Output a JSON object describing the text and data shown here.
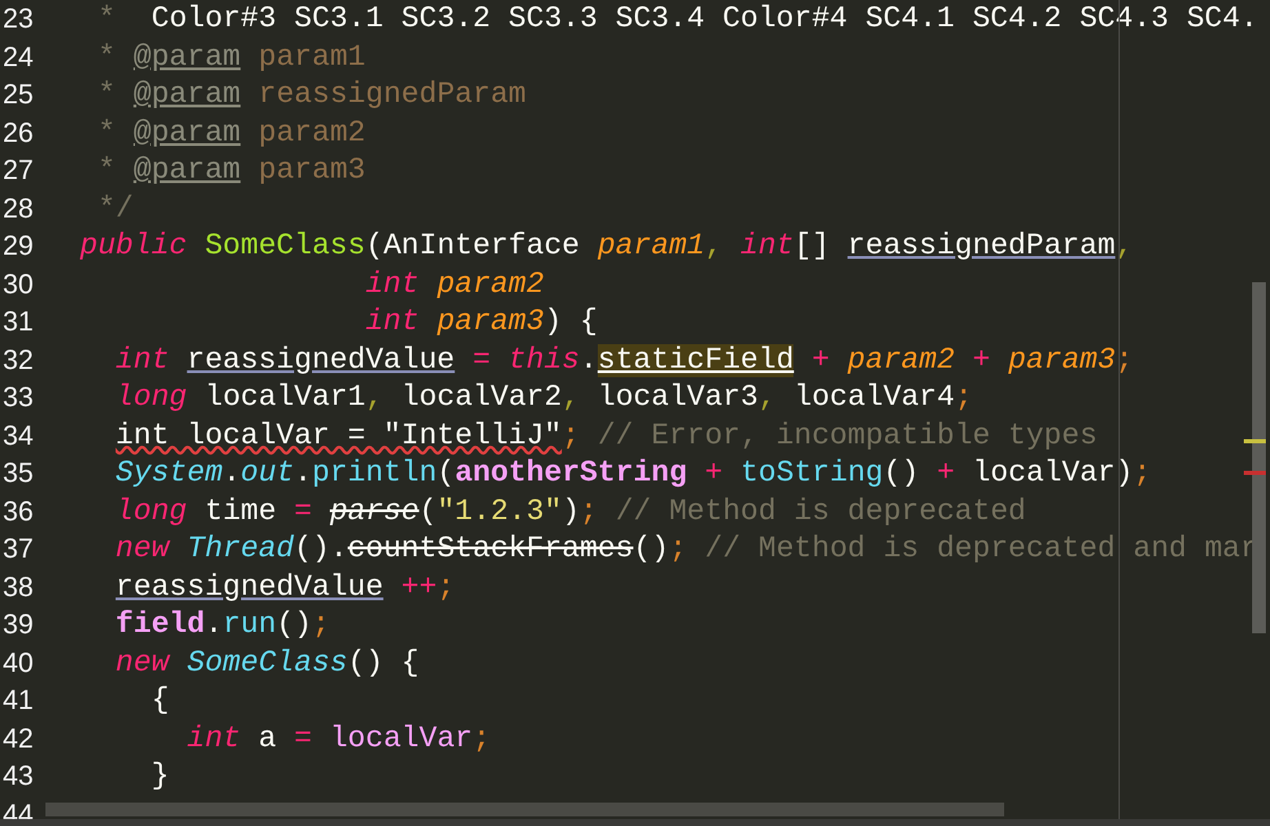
{
  "editor": {
    "lines": [
      {
        "number": "23",
        "tokens": [
          {
            "kind": "comment",
            "text": " *"
          },
          {
            "kind": "text",
            "text": "  Color#3 SC3.1 SC3.2 SC3.3 SC3.4 Color#4 SC4.1 SC4.2 SC4.3 SC4."
          }
        ]
      },
      {
        "number": "24",
        "tokens": [
          {
            "kind": "comment",
            "text": " * "
          },
          {
            "kind": "doctag",
            "text": "@param"
          },
          {
            "kind": "docparam",
            "text": " param1"
          }
        ]
      },
      {
        "number": "25",
        "tokens": [
          {
            "kind": "comment",
            "text": " * "
          },
          {
            "kind": "doctag",
            "text": "@param"
          },
          {
            "kind": "docparam",
            "text": " reassignedParam"
          }
        ]
      },
      {
        "number": "26",
        "tokens": [
          {
            "kind": "comment",
            "text": " * "
          },
          {
            "kind": "doctag",
            "text": "@param"
          },
          {
            "kind": "docparam",
            "text": " param2"
          }
        ]
      },
      {
        "number": "27",
        "tokens": [
          {
            "kind": "comment",
            "text": " * "
          },
          {
            "kind": "doctag",
            "text": "@param"
          },
          {
            "kind": "docparam",
            "text": " param3"
          }
        ]
      },
      {
        "number": "28",
        "tokens": [
          {
            "kind": "comment",
            "text": " */"
          }
        ]
      },
      {
        "number": "29",
        "tokens": [
          {
            "kind": "keyword",
            "text": "public "
          },
          {
            "kind": "declaration",
            "text": "SomeClass"
          },
          {
            "kind": "text",
            "text": "(AnInterface "
          },
          {
            "kind": "param",
            "text": "param1"
          },
          {
            "kind": "comma",
            "text": ", "
          },
          {
            "kind": "keyword",
            "text": "int"
          },
          {
            "kind": "text",
            "text": "[] "
          },
          {
            "kind": "reassigned",
            "text": "reassignedParam"
          },
          {
            "kind": "comma",
            "text": ","
          }
        ]
      },
      {
        "number": "30",
        "tokens": [
          {
            "kind": "keyword",
            "text": "                int "
          },
          {
            "kind": "param",
            "text": "param2"
          }
        ]
      },
      {
        "number": "31",
        "tokens": [
          {
            "kind": "keyword",
            "text": "                int "
          },
          {
            "kind": "param",
            "text": "param3"
          },
          {
            "kind": "text",
            "text": ") {"
          }
        ]
      },
      {
        "number": "32",
        "tokens": [
          {
            "kind": "keyword",
            "text": "  int "
          },
          {
            "kind": "reassigned",
            "text": "reassignedValue"
          },
          {
            "kind": "operator",
            "text": " = "
          },
          {
            "kind": "keyword",
            "text": "this"
          },
          {
            "kind": "text",
            "text": "."
          },
          {
            "kind": "static",
            "text": "staticField"
          },
          {
            "kind": "operator",
            "text": " + "
          },
          {
            "kind": "param",
            "text": "param2"
          },
          {
            "kind": "operator",
            "text": " + "
          },
          {
            "kind": "param",
            "text": "param3"
          },
          {
            "kind": "semicolon",
            "text": ";"
          }
        ]
      },
      {
        "number": "33",
        "tokens": [
          {
            "kind": "keyword",
            "text": "  long"
          },
          {
            "kind": "text",
            "text": " localVar1"
          },
          {
            "kind": "comma",
            "text": ","
          },
          {
            "kind": "text",
            "text": " localVar2"
          },
          {
            "kind": "comma",
            "text": ","
          },
          {
            "kind": "text",
            "text": " localVar3"
          },
          {
            "kind": "comma",
            "text": ","
          },
          {
            "kind": "text",
            "text": " localVar4"
          },
          {
            "kind": "semicolon",
            "text": ";"
          }
        ]
      },
      {
        "number": "34",
        "tokens": [
          {
            "kind": "error",
            "text": "  int localVar = \"IntelliJ\""
          },
          {
            "kind": "semicolon",
            "text": ";"
          },
          {
            "kind": "comment",
            "text": " // Error, incompatible types"
          }
        ]
      },
      {
        "number": "35",
        "tokens": [
          {
            "kind": "type",
            "text": "  System"
          },
          {
            "kind": "text",
            "text": "."
          },
          {
            "kind": "type",
            "text": "out"
          },
          {
            "kind": "text",
            "text": "."
          },
          {
            "kind": "call",
            "text": "println"
          },
          {
            "kind": "text",
            "text": "("
          },
          {
            "kind": "field",
            "text": "anotherString"
          },
          {
            "kind": "operator",
            "text": " + "
          },
          {
            "kind": "call",
            "text": "toString"
          },
          {
            "kind": "text",
            "text": "() "
          },
          {
            "kind": "operator",
            "text": "+"
          },
          {
            "kind": "text",
            "text": " localVar)"
          },
          {
            "kind": "semicolon",
            "text": ";"
          }
        ]
      },
      {
        "number": "36",
        "tokens": [
          {
            "kind": "keyword",
            "text": "  long"
          },
          {
            "kind": "text",
            "text": " time "
          },
          {
            "kind": "operator",
            "text": "= "
          },
          {
            "kind": "deprecated_static",
            "text": "parse"
          },
          {
            "kind": "text",
            "text": "("
          },
          {
            "kind": "string",
            "text": "\"1.2.3\""
          },
          {
            "kind": "text",
            "text": ")"
          },
          {
            "kind": "semicolon",
            "text": ";"
          },
          {
            "kind": "comment",
            "text": " // Method is deprecated"
          }
        ]
      },
      {
        "number": "37",
        "tokens": [
          {
            "kind": "keyword",
            "text": "  new "
          },
          {
            "kind": "type",
            "text": "Thread"
          },
          {
            "kind": "text",
            "text": "()."
          },
          {
            "kind": "deprecated",
            "text": "countStackFrames"
          },
          {
            "kind": "text",
            "text": "()"
          },
          {
            "kind": "semicolon",
            "text": ";"
          },
          {
            "kind": "comment",
            "text": " // Method is deprecated and mar"
          }
        ]
      },
      {
        "number": "38",
        "tokens": [
          {
            "kind": "reassigned",
            "text": "  reassignedValue"
          },
          {
            "kind": "operator",
            "text": " ++"
          },
          {
            "kind": "semicolon",
            "text": ";"
          }
        ]
      },
      {
        "number": "39",
        "tokens": [
          {
            "kind": "field",
            "text": "  field"
          },
          {
            "kind": "text",
            "text": "."
          },
          {
            "kind": "call",
            "text": "run"
          },
          {
            "kind": "text",
            "text": "()"
          },
          {
            "kind": "semicolon",
            "text": ";"
          }
        ]
      },
      {
        "number": "40",
        "tokens": [
          {
            "kind": "keyword",
            "text": "  new "
          },
          {
            "kind": "type",
            "text": "SomeClass"
          },
          {
            "kind": "text",
            "text": "() {"
          }
        ]
      },
      {
        "number": "41",
        "tokens": [
          {
            "kind": "text",
            "text": "    {"
          }
        ]
      },
      {
        "number": "42",
        "tokens": [
          {
            "kind": "keyword",
            "text": "      int"
          },
          {
            "kind": "text",
            "text": " a "
          },
          {
            "kind": "operator",
            "text": "= "
          },
          {
            "kind": "local",
            "text": "localVar"
          },
          {
            "kind": "semicolon",
            "text": ";"
          }
        ]
      },
      {
        "number": "43",
        "tokens": [
          {
            "kind": "text",
            "text": "    }"
          }
        ]
      },
      {
        "number": "44"
      }
    ]
  }
}
